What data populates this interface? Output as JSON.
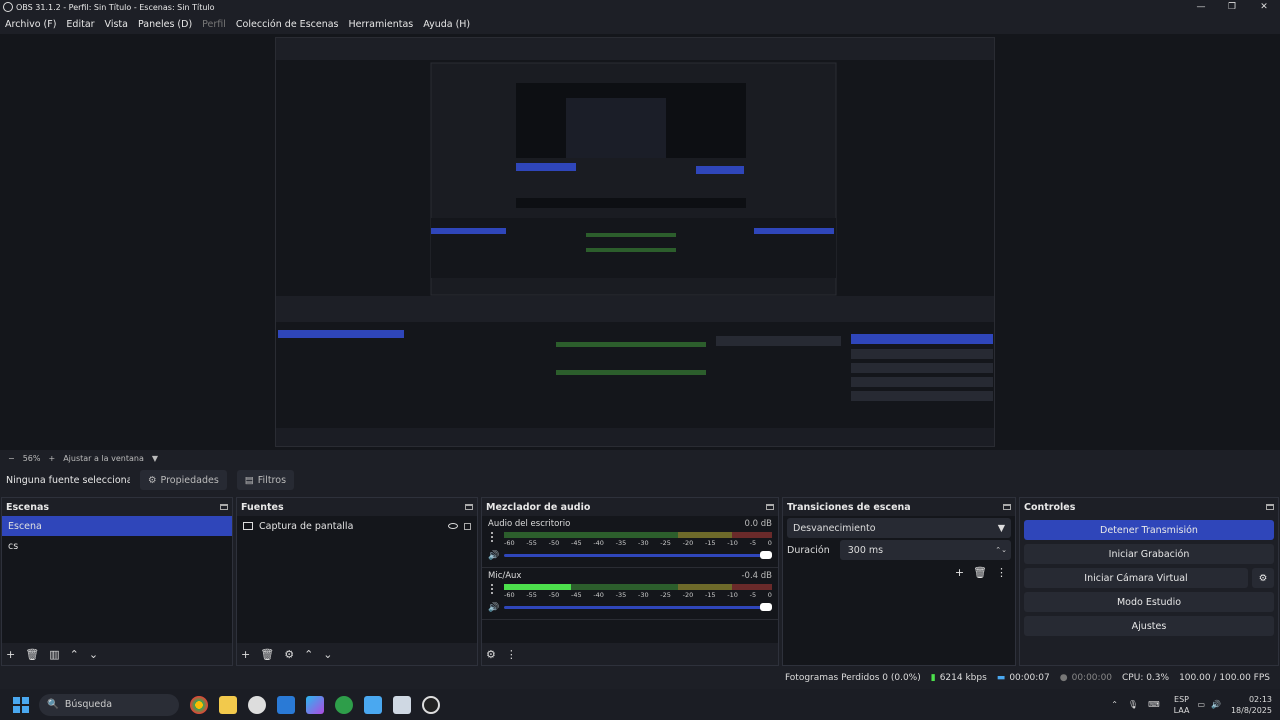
{
  "window": {
    "title": "OBS 31.1.2 - Perfil: Sin Título - Escenas: Sin Título",
    "minimize_label": "—",
    "maximize_label": "❐",
    "close_label": "✕"
  },
  "menu": [
    "Archivo (F)",
    "Editar",
    "Vista",
    "Paneles (D)",
    "Perfil",
    "Colección de Escenas",
    "Herramientas",
    "Ayuda (H)"
  ],
  "zoom": {
    "minus": "−",
    "level": "56%",
    "plus": "+",
    "fit_label": "Ajustar a la ventana"
  },
  "properties_bar": {
    "no_source": "Ninguna fuente seleccionada",
    "properties_label": "Propiedades",
    "filters_label": "Filtros"
  },
  "scenes": {
    "title": "Escenas",
    "items": [
      "Escena",
      "cs"
    ],
    "selected_index": 0
  },
  "sources": {
    "title": "Fuentes",
    "items": [
      "Captura de pantalla"
    ]
  },
  "mixer": {
    "title": "Mezclador de audio",
    "scale": [
      "-60",
      "-55",
      "-50",
      "-45",
      "-40",
      "-35",
      "-30",
      "-25",
      "-20",
      "-15",
      "-10",
      "-5",
      "0"
    ],
    "channels": [
      {
        "name": "Audio del escritorio",
        "db": "0.0 dB",
        "level": 0.0
      },
      {
        "name": "Mic/Aux",
        "db": "-0.4 dB",
        "level": 0.25
      }
    ]
  },
  "transitions": {
    "title": "Transiciones de escena",
    "selected": "Desvanecimiento",
    "duration_label": "Duración",
    "duration_value": "300 ms"
  },
  "controls": {
    "title": "Controles",
    "stop_stream": "Detener Transmisión",
    "start_recording": "Iniciar Grabación",
    "start_virtual_cam": "Iniciar Cámara Virtual",
    "studio_mode": "Modo Estudio",
    "settings": "Ajustes"
  },
  "status": {
    "dropped_frames": "Fotogramas Perdidos 0 (0.0%)",
    "bitrate": "6214 kbps",
    "stream_time": "00:00:07",
    "record_time": "00:00:00",
    "cpu": "CPU: 0.3%",
    "fps": "100.00 / 100.00 FPS"
  },
  "taskbar": {
    "search_placeholder": "Búsqueda",
    "lang_top": "ESP",
    "lang_bottom": "LAA",
    "time": "02:13",
    "date": "18/8/2025"
  },
  "colors": {
    "accent": "#2f46ba",
    "background": "#1d1f26",
    "panel": "#14161b",
    "meter_green": "#4ce04c"
  }
}
